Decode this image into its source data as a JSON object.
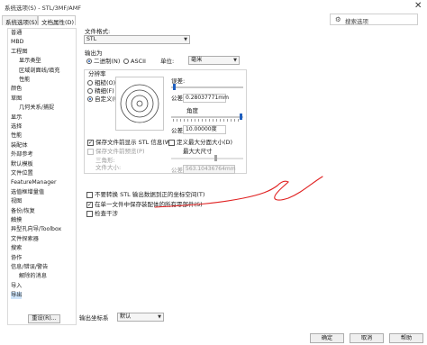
{
  "window": {
    "title": "系统选项(S) - STL/3MF/AMF",
    "close": "✕"
  },
  "tabs": [
    {
      "label": "系统选项(S)"
    },
    {
      "label": "文档属性(D)"
    }
  ],
  "search": {
    "placeholder": "搜索选项"
  },
  "tree": {
    "items": [
      "普通",
      "MBD",
      "工程图",
      "显示类型",
      "区域剖面线/填充",
      "性能",
      "颜色",
      "草图",
      "几何关系/捕捉",
      "显示",
      "选择",
      "性能",
      "装配体",
      "外部参考",
      "默认模板",
      "文件位置",
      "FeatureManager",
      "选值框增量值",
      "视图",
      "备份/恢复",
      "触摸",
      "异型孔向导/Toolbox",
      "文件探索器",
      "搜索",
      "协作",
      "信息/错误/警告",
      "解除的消息",
      "导入",
      "导出"
    ],
    "selected_index": 28,
    "reset_label": "重设(R)..."
  },
  "format": {
    "label": "文件格式:",
    "value": "STL"
  },
  "output": {
    "label": "输出为",
    "binary_label": "二进制(N)",
    "ascii_label": "ASCII",
    "unit_label": "单位:",
    "unit_value": "毫米"
  },
  "resolution": {
    "label": "分辨率",
    "options": [
      "粗糙(O)",
      "精细(F)",
      "自定义(U)"
    ],
    "selected": "自定义(U)",
    "deviation_label": "误差:",
    "tolerance_label": "公差:",
    "tolerance_value": "0.28037771mm",
    "angle_label": "角度",
    "angle_tolerance_label": "公差:",
    "angle_value": "10.00000度",
    "show_info_label": "保存文件前显示 STL 信息(W)",
    "preview_label": "保存文件前预览(P)",
    "triangles_label": "三角形:",
    "filesize_label": "文件大小:",
    "max_side_chk_label": "定义最大分面大小(D)",
    "max_side_label": "最大大尺寸",
    "max_side_tolerance_label": "公差:",
    "max_side_value": "563.10436764mm"
  },
  "options": [
    {
      "label": "不要转换 STL 输出数据到正的坐标空间(T)",
      "checked": false
    },
    {
      "label": "在单一文件中保存装配体的所有零部件(S)",
      "checked": true
    },
    {
      "label": "检查干涉",
      "checked": false
    }
  ],
  "bottom": {
    "coord_label": "输出坐标系",
    "coord_value": "默认",
    "ok": "确定",
    "cancel": "取消",
    "help": "帮助"
  },
  "annotation": {
    "color": "#e02020"
  }
}
